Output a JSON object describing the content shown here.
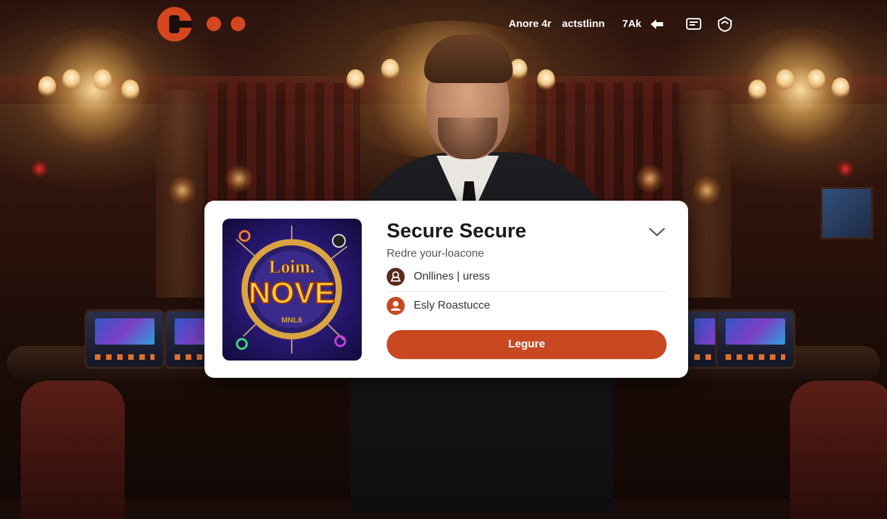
{
  "nav": {
    "links": [
      "Anore 4r",
      "actstlinn",
      "7Ak"
    ],
    "logo_icon": "brand-logo-icon",
    "icons": [
      "back-arrow-icon",
      "wallet-icon",
      "shield-icon"
    ]
  },
  "card": {
    "title": "Secure Secure",
    "subtitle": "Redre your-loacone",
    "fields": [
      {
        "label": "Onllines | uress",
        "icon": "user-badge-icon"
      },
      {
        "label": "Esly Roastucce",
        "icon": "person-icon"
      }
    ],
    "button_label": "Legure",
    "game_art": {
      "line1": "Loim.",
      "line2": "NOVE",
      "line3": "MNL6"
    }
  },
  "colors": {
    "accent": "#d4471e",
    "button": "#c84821",
    "card_bg": "#ffffff"
  }
}
